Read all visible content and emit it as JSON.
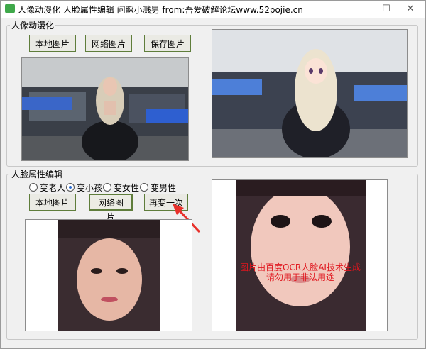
{
  "window": {
    "title": "人像动漫化 人脸属性编辑 问睬小溅男 from:吾爱破解论坛www.52pojie.cn",
    "min_glyph": "—",
    "max_glyph": "☐",
    "close_glyph": "✕"
  },
  "anime_group": {
    "legend": "人像动漫化",
    "local_btn": "本地图片",
    "web_btn": "网络图片",
    "save_btn": "保存图片"
  },
  "face_group": {
    "legend": "人脸属性编辑",
    "radios": [
      {
        "label": "变老人",
        "checked": false
      },
      {
        "label": "变小孩",
        "checked": true
      },
      {
        "label": "变女性",
        "checked": false
      },
      {
        "label": "变男性",
        "checked": false
      }
    ],
    "local_btn": "本地图片",
    "web_btn": "网络图片",
    "again_btn": "再变一次"
  },
  "result_notice": {
    "line1": "图片由百度OCR人脸AI技术生成",
    "line2": "请勿用于非法用途"
  },
  "colors": {
    "accent_border": "#5f7d3b",
    "notice_red": "#e0161e",
    "arrow_red": "#e8302a"
  }
}
